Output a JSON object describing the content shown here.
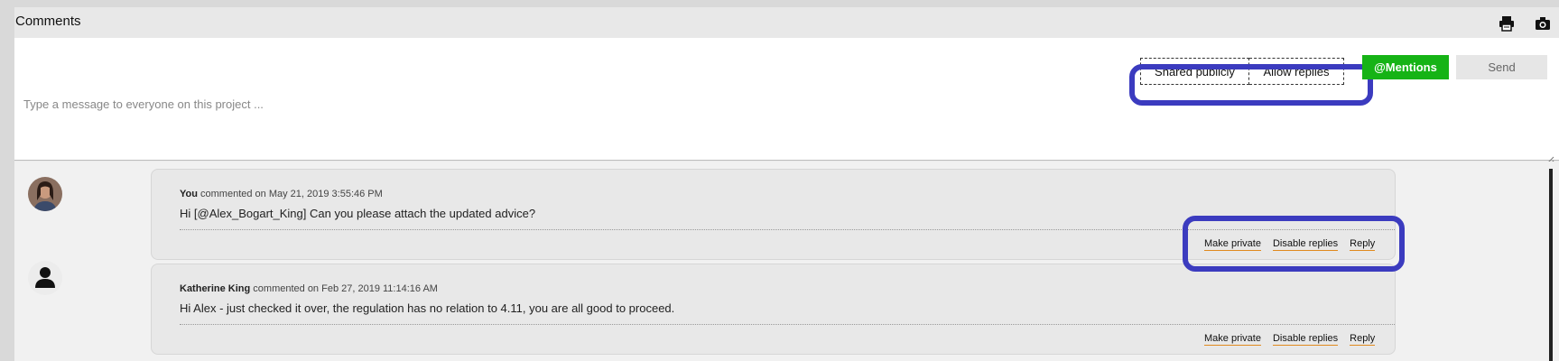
{
  "header": {
    "title": "Comments",
    "print_icon": "print-icon",
    "camera_icon": "camera-icon"
  },
  "compose": {
    "placeholder": "Type a message to everyone on this project ...",
    "toggle_shared": "Shared publicly",
    "toggle_replies": "Allow replies",
    "mentions_label": "@Mentions",
    "send_label": "Send"
  },
  "colors": {
    "mentions": "#16b316",
    "highlight": "#3b3bbf",
    "link_underline": "#e08a1e"
  },
  "comments": [
    {
      "author": "You",
      "meta": " commented on May 21, 2019 3:55:46 PM",
      "text": "Hi [@Alex_Bogart_King] Can you please attach the updated advice?",
      "actions": [
        "Make private",
        "Disable replies",
        "Reply"
      ]
    },
    {
      "author": "Katherine King",
      "meta": " commented on Feb 27, 2019 11:14:16 AM",
      "text": "Hi Alex - just checked it over, the regulation has no relation to 4.11, you are all good to proceed.",
      "actions": [
        "Make private",
        "Disable replies",
        "Reply"
      ]
    }
  ]
}
